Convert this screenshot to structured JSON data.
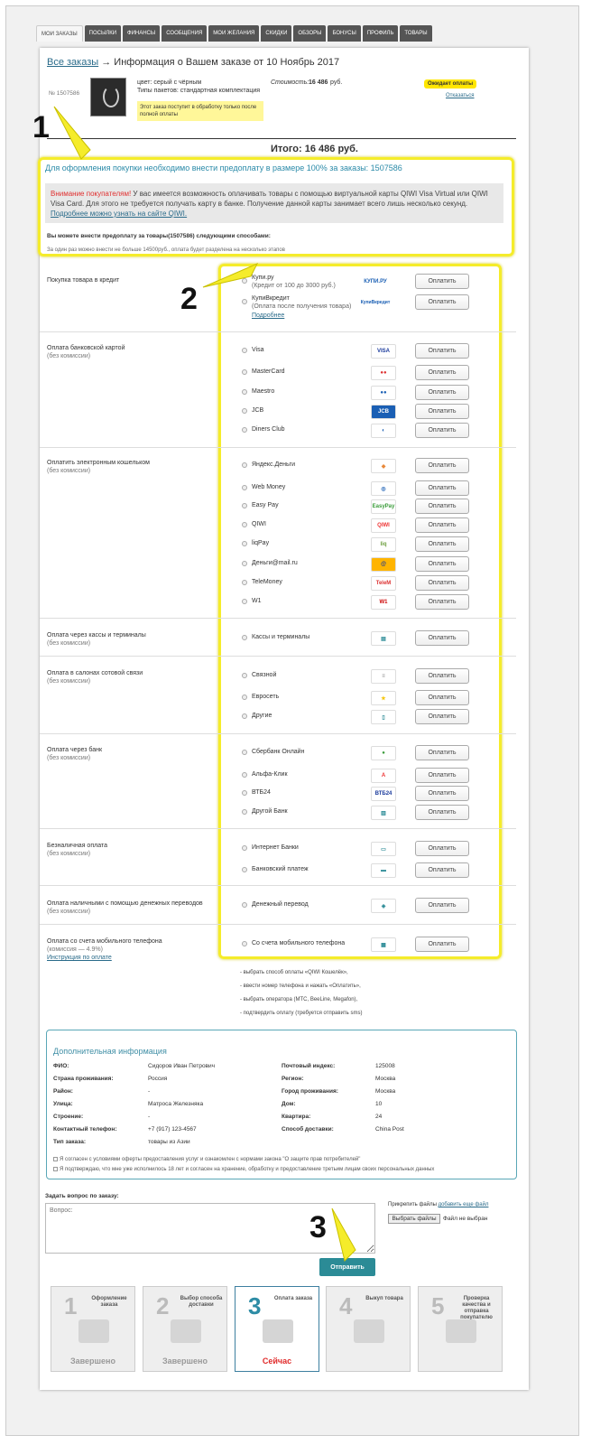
{
  "tabs": [
    "МОИ ЗАКАЗЫ",
    "ПОСЫЛКИ",
    "ФИНАНСЫ",
    "СООБЩЕНИЯ",
    "МОИ ЖЕЛАНИЯ",
    "СКИДКИ",
    "ОБЗОРЫ",
    "БОНУСЫ",
    "ПРОФИЛЬ",
    "ТОВАРЫ"
  ],
  "title": {
    "link": "Все заказы",
    "rest": " → Информация о Вашем заказе от 10 Ноябрь 2017"
  },
  "order": {
    "number": "№ 1507586",
    "color": "цвет: серый с чёрным",
    "package": "Типы пакетов: стандартная комплектация",
    "notice": "Этот заказ поступит в обработку только после полной оплаты",
    "cost_label": "Стоимость:",
    "cost": "16 486",
    "currency": "руб.",
    "status": "Ожидает оплаты",
    "refuse": "Отказаться"
  },
  "total": "Итого: 16 486 руб.",
  "prepay": "Для оформления покупки необходимо внести предоплату в размере  100% за заказы: 1507586",
  "alert": {
    "red": "Внимание покупателям!",
    "text": " У вас имеется возможность оплачивать товары с помощью виртуальной карты QIWI Visa Virtual или QIWI Visa Card. Для этого не требуется получать карту в банке. Получение данной карты занимает всего лишь несколько секунд. ",
    "link": "Подробнее можно узнать на сайте QIWI."
  },
  "sub1": "Вы можете внести предоплату за товары(1507586) следующими способами:",
  "sub2": "За один раз можно внести не больше 14500руб., оплата будет разделена на несколько этапов",
  "pay_button": "Оплатить",
  "categories": [
    {
      "title": "Покупка товара в кредит",
      "note": ""
    },
    {
      "title": "Оплата банковской картой",
      "note": "(без комиссии)"
    },
    {
      "title": "Оплатить электронным кошельком",
      "note": "(без комиссии)"
    },
    {
      "title": "Оплата через кассы и терминалы",
      "note": "(без комиссии)"
    },
    {
      "title": "Оплата в салонах сотовой связи",
      "note": "(без комиссии)"
    },
    {
      "title": "Оплата через банк",
      "note": "(без комиссии)"
    },
    {
      "title": "Безналичная оплата",
      "note": "(без комиссии)"
    },
    {
      "title": "Оплата наличными с помощью денежных переводов",
      "note": "(без комиссии)"
    },
    {
      "title": "Оплата со счета мобильного телефона",
      "note": "(комиссия — 4.9%)",
      "link": "Инструкция по оплате"
    }
  ],
  "credit": {
    "kupi": "Купи.ру",
    "kupi_note": "(Кредит от 100 до 3000 руб.)",
    "kupi_logo": "КУПИ.РУ",
    "kupiv": "КупиВкредит",
    "kupiv_note": "(Оплата после получения товара)",
    "kupiv_logo": "КупиВкредит",
    "more": "Подробнее"
  },
  "options": [
    "Visa",
    "MasterCard",
    "Maestro",
    "JCB",
    "Diners Club",
    "Яндекс.Деньги",
    "Web Money",
    "Easy Pay",
    "QIWI",
    "liqPay",
    "Деньги@mail.ru",
    "TeleMoney",
    "W1",
    "Кассы и терминалы",
    "Связной",
    "Евросеть",
    "Другие",
    "Сбербанк Онлайн",
    "Альфа-Клик",
    "ВТБ24",
    "Другой Банк",
    "Интернет Банки",
    "Банковский платеж",
    "Денежный перевод",
    "Со счета мобильного телефона"
  ],
  "logo_text": {
    "Visa": "VISA",
    "QIWI": "QIWI",
    "W1": "W1",
    "ВТБ24": "ВТБ24",
    "Easy Pay": "EasyPay"
  },
  "instructions": [
    "- выбрать способ оплаты «QIWI Кошелёк»,",
    "- ввести номер телефона и нажать «Оплатить»,",
    "- выбрать оператора (МТС, BeeLine, Megafon),",
    "- подтвердить оплату (требуется отправить sms)"
  ],
  "addl": {
    "heading": "Дополнительная информация",
    "left": [
      [
        "ФИО:",
        "Сидоров Иван Петрович"
      ],
      [
        "Страна проживания:",
        "Россия"
      ],
      [
        "Район:",
        "-"
      ],
      [
        "Улица:",
        "Матроса Железняка"
      ],
      [
        "Строение:",
        "-"
      ],
      [
        "Контактный телефон:",
        "+7 (917) 123-4567"
      ],
      [
        "Тип заказа:",
        "товары из Азии"
      ]
    ],
    "right": [
      [
        "Почтовый индекс:",
        "125008"
      ],
      [
        "Регион:",
        "Москва"
      ],
      [
        "Город проживания:",
        "Москва"
      ],
      [
        "Дом:",
        "10"
      ],
      [
        "Квартира:",
        "24"
      ],
      [
        "Способ доставки:",
        "China Post"
      ]
    ],
    "agree1": "Я согласен с условиями оферты предоставления услуг и ознакомлен с нормами закона \"О защите прав потребителей\"",
    "agree2": "Я подтверждаю, что мне уже исполнилось 18 лет и согласен на хранение, обработку и предоставление третьим лицам своих персональных данных"
  },
  "question": {
    "label": "Задать вопрос по заказу:",
    "placeholder": "Вопрос:",
    "attach": "Прикрепить файлы",
    "attach_more": "добавить еще файл",
    "file_btn": "Выбрать файлы",
    "no_file": "Файл не выбран",
    "send": "Отправить"
  },
  "steps": [
    {
      "num": "1",
      "title": "Оформление заказа",
      "status": "Завершено"
    },
    {
      "num": "2",
      "title": "Выбор способа доставки",
      "status": "Завершено"
    },
    {
      "num": "3",
      "title": "Оплата заказа",
      "status": "Сейчас"
    },
    {
      "num": "4",
      "title": "Выкуп товара",
      "status": ""
    },
    {
      "num": "5",
      "title": "Проверка качества и отправка покупателю",
      "status": ""
    }
  ],
  "markers": [
    "1",
    "2",
    "3"
  ],
  "colors": {
    "highlight": "#f5ec2a",
    "accent": "#2b8b96",
    "alert_red": "#e03030"
  }
}
